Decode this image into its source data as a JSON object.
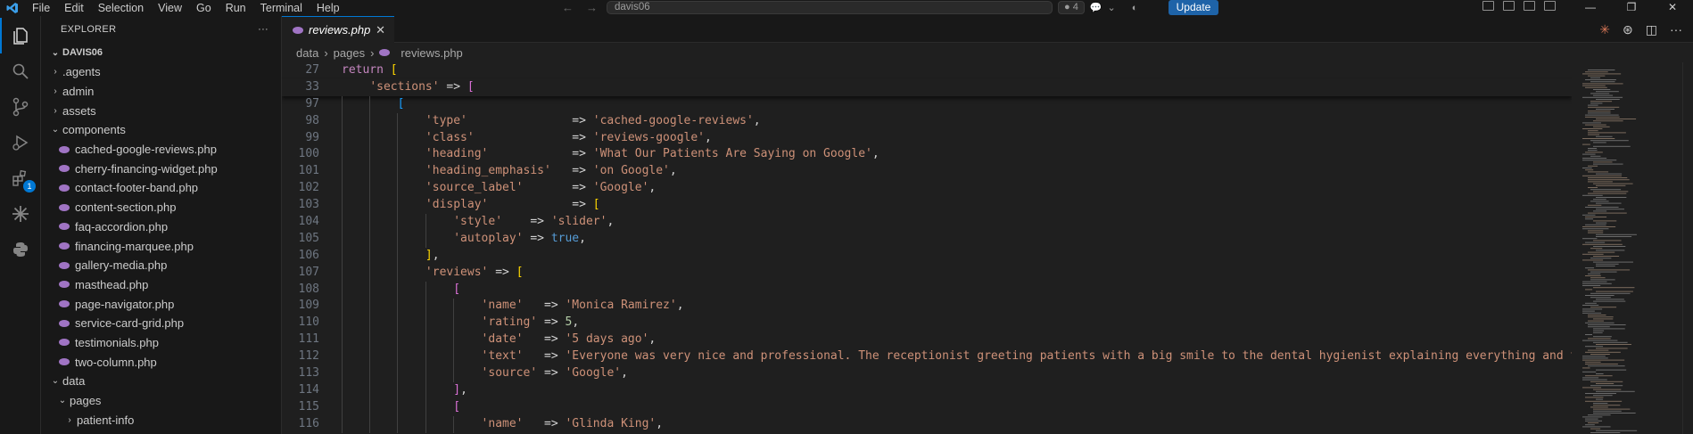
{
  "titlebar": {
    "menu": [
      "File",
      "Edit",
      "Selection",
      "View",
      "Go",
      "Run",
      "Terminal",
      "Help"
    ],
    "search_text": "davis06",
    "accounts_count": "4",
    "update_label": "Update"
  },
  "activity": {
    "extensions_badge": "1"
  },
  "sidebar": {
    "title": "EXPLORER",
    "more": "···",
    "root": "DAVIS06",
    "tree": [
      {
        "label": ".agents",
        "type": "folder",
        "indent": 1,
        "open": false
      },
      {
        "label": "admin",
        "type": "folder",
        "indent": 1,
        "open": false
      },
      {
        "label": "assets",
        "type": "folder",
        "indent": 1,
        "open": false
      },
      {
        "label": "components",
        "type": "folder",
        "indent": 1,
        "open": true
      },
      {
        "label": "cached-google-reviews.php",
        "type": "file",
        "indent": 2
      },
      {
        "label": "cherry-financing-widget.php",
        "type": "file",
        "indent": 2
      },
      {
        "label": "contact-footer-band.php",
        "type": "file",
        "indent": 2
      },
      {
        "label": "content-section.php",
        "type": "file",
        "indent": 2
      },
      {
        "label": "faq-accordion.php",
        "type": "file",
        "indent": 2
      },
      {
        "label": "financing-marquee.php",
        "type": "file",
        "indent": 2
      },
      {
        "label": "gallery-media.php",
        "type": "file",
        "indent": 2
      },
      {
        "label": "masthead.php",
        "type": "file",
        "indent": 2
      },
      {
        "label": "page-navigator.php",
        "type": "file",
        "indent": 2
      },
      {
        "label": "service-card-grid.php",
        "type": "file",
        "indent": 2
      },
      {
        "label": "testimonials.php",
        "type": "file",
        "indent": 2
      },
      {
        "label": "two-column.php",
        "type": "file",
        "indent": 2
      },
      {
        "label": "data",
        "type": "folder",
        "indent": 1,
        "open": true
      },
      {
        "label": "pages",
        "type": "folder",
        "indent": 2,
        "open": true
      },
      {
        "label": "patient-info",
        "type": "folder",
        "indent": 3,
        "open": false
      }
    ]
  },
  "editor": {
    "tab_label": "reviews.php",
    "tab_close": "✕",
    "breadcrumb": [
      "data",
      "pages",
      "reviews.php"
    ],
    "sticky": [
      {
        "n": "27",
        "code": [
          [
            "return",
            "kw"
          ],
          [
            " ",
            "txt"
          ],
          [
            "[",
            "br1"
          ]
        ]
      },
      {
        "n": "33",
        "code": [
          [
            "    ",
            "txt"
          ],
          [
            "'sections'",
            "str"
          ],
          [
            " => ",
            "op"
          ],
          [
            "[",
            "br2"
          ]
        ]
      }
    ],
    "lines": [
      {
        "n": "97",
        "code": [
          [
            "        ",
            "txt"
          ],
          [
            "[",
            "br3"
          ]
        ]
      },
      {
        "n": "98",
        "code": [
          [
            "            ",
            "txt"
          ],
          [
            "'type'",
            "str"
          ],
          [
            "               => ",
            "op"
          ],
          [
            "'cached-google-reviews'",
            "str"
          ],
          [
            ",",
            "op"
          ]
        ]
      },
      {
        "n": "99",
        "code": [
          [
            "            ",
            "txt"
          ],
          [
            "'class'",
            "str"
          ],
          [
            "              => ",
            "op"
          ],
          [
            "'reviews-google'",
            "str"
          ],
          [
            ",",
            "op"
          ]
        ]
      },
      {
        "n": "100",
        "code": [
          [
            "            ",
            "txt"
          ],
          [
            "'heading'",
            "str"
          ],
          [
            "            => ",
            "op"
          ],
          [
            "'What Our Patients Are Saying on Google'",
            "str"
          ],
          [
            ",",
            "op"
          ]
        ]
      },
      {
        "n": "101",
        "code": [
          [
            "            ",
            "txt"
          ],
          [
            "'heading_emphasis'",
            "str"
          ],
          [
            "   => ",
            "op"
          ],
          [
            "'on Google'",
            "str"
          ],
          [
            ",",
            "op"
          ]
        ]
      },
      {
        "n": "102",
        "code": [
          [
            "            ",
            "txt"
          ],
          [
            "'source_label'",
            "str"
          ],
          [
            "       => ",
            "op"
          ],
          [
            "'Google'",
            "str"
          ],
          [
            ",",
            "op"
          ]
        ]
      },
      {
        "n": "103",
        "code": [
          [
            "            ",
            "txt"
          ],
          [
            "'display'",
            "str"
          ],
          [
            "            => ",
            "op"
          ],
          [
            "[",
            "br1"
          ]
        ]
      },
      {
        "n": "104",
        "code": [
          [
            "                ",
            "txt"
          ],
          [
            "'style'",
            "str"
          ],
          [
            "    => ",
            "op"
          ],
          [
            "'slider'",
            "str"
          ],
          [
            ",",
            "op"
          ]
        ]
      },
      {
        "n": "105",
        "code": [
          [
            "                ",
            "txt"
          ],
          [
            "'autoplay'",
            "str"
          ],
          [
            " => ",
            "op"
          ],
          [
            "true",
            "bool"
          ],
          [
            ",",
            "op"
          ]
        ]
      },
      {
        "n": "106",
        "code": [
          [
            "            ",
            "txt"
          ],
          [
            "]",
            "br1"
          ],
          [
            ",",
            "op"
          ]
        ]
      },
      {
        "n": "107",
        "code": [
          [
            "            ",
            "txt"
          ],
          [
            "'reviews'",
            "str"
          ],
          [
            " => ",
            "op"
          ],
          [
            "[",
            "br1"
          ]
        ]
      },
      {
        "n": "108",
        "code": [
          [
            "                ",
            "txt"
          ],
          [
            "[",
            "br2"
          ]
        ]
      },
      {
        "n": "109",
        "code": [
          [
            "                    ",
            "txt"
          ],
          [
            "'name'",
            "str"
          ],
          [
            "   => ",
            "op"
          ],
          [
            "'Monica Ramirez'",
            "str"
          ],
          [
            ",",
            "op"
          ]
        ]
      },
      {
        "n": "110",
        "code": [
          [
            "                    ",
            "txt"
          ],
          [
            "'rating'",
            "str"
          ],
          [
            " => ",
            "op"
          ],
          [
            "5",
            "num"
          ],
          [
            ",",
            "op"
          ]
        ]
      },
      {
        "n": "111",
        "code": [
          [
            "                    ",
            "txt"
          ],
          [
            "'date'",
            "str"
          ],
          [
            "   => ",
            "op"
          ],
          [
            "'5 days ago'",
            "str"
          ],
          [
            ",",
            "op"
          ]
        ]
      },
      {
        "n": "112",
        "code": [
          [
            "                    ",
            "txt"
          ],
          [
            "'text'",
            "str"
          ],
          [
            "   => ",
            "op"
          ],
          [
            "'Everyone was very nice and professional. The receptionist greeting patients with a big smile to the dental hygienist explaining everything and taking",
            "str"
          ]
        ]
      },
      {
        "n": "113",
        "code": [
          [
            "                    ",
            "txt"
          ],
          [
            "'source'",
            "str"
          ],
          [
            " => ",
            "op"
          ],
          [
            "'Google'",
            "str"
          ],
          [
            ",",
            "op"
          ]
        ]
      },
      {
        "n": "114",
        "code": [
          [
            "                ",
            "txt"
          ],
          [
            "]",
            "br2"
          ],
          [
            ",",
            "op"
          ]
        ]
      },
      {
        "n": "115",
        "code": [
          [
            "                ",
            "txt"
          ],
          [
            "[",
            "br2"
          ]
        ]
      },
      {
        "n": "116",
        "code": [
          [
            "                    ",
            "txt"
          ],
          [
            "'name'",
            "str"
          ],
          [
            "   => ",
            "op"
          ],
          [
            "'Glinda King'",
            "str"
          ],
          [
            ",",
            "op"
          ]
        ]
      }
    ]
  },
  "colors": {
    "accent": "#0078d4",
    "php_icon": "#a074c4",
    "string": "#ce9178",
    "keyword": "#c586c0"
  }
}
